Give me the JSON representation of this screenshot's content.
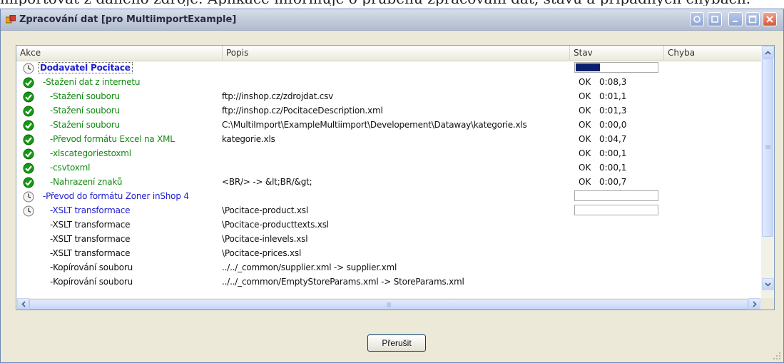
{
  "background_text": "importovat z daného zdroje. Aplikace informuje o průběhu zpracování dat, stavu  a případných chybách.",
  "window": {
    "title": "Zpracování dat [pro MultiimportExample]"
  },
  "columns": [
    "Akce",
    "Popis",
    "Stav",
    "Chyba"
  ],
  "rows": [
    {
      "status": "clock",
      "level": 0,
      "color": "blue",
      "akce": "Dodavatel Pocitace",
      "popis": "",
      "stav": "",
      "cas": "",
      "progress": 0.3
    },
    {
      "status": "ok",
      "level": 1,
      "color": "green",
      "akce": "-Stažení dat z internetu",
      "popis": "",
      "stav": "OK",
      "cas": "0:08,3"
    },
    {
      "status": "ok",
      "level": 2,
      "color": "green",
      "akce": "-Stažení souboru",
      "popis": "ftp://inshop.cz/zdrojdat.csv",
      "stav": "OK",
      "cas": "0:01,1"
    },
    {
      "status": "ok",
      "level": 2,
      "color": "green",
      "akce": "-Stažení souboru",
      "popis": "ftp://inshop.cz/PocitaceDescription.xml",
      "stav": "OK",
      "cas": "0:01,3"
    },
    {
      "status": "ok",
      "level": 2,
      "color": "green",
      "akce": "-Stažení souboru",
      "popis": "C:\\MultiImport\\ExampleMultiimport\\Developement\\Dataway\\kategorie.xls",
      "stav": "OK",
      "cas": "0:00,0"
    },
    {
      "status": "ok",
      "level": 2,
      "color": "green",
      "akce": "-Převod formátu Excel na XML",
      "popis": "kategorie.xls",
      "stav": "OK",
      "cas": "0:04,7"
    },
    {
      "status": "ok",
      "level": 2,
      "color": "green",
      "akce": "-xlscategoriestoxml",
      "popis": "",
      "stav": "OK",
      "cas": "0:00,1"
    },
    {
      "status": "ok",
      "level": 2,
      "color": "green",
      "akce": "-csvtoxml",
      "popis": "",
      "stav": "OK",
      "cas": "0:00,1"
    },
    {
      "status": "ok",
      "level": 2,
      "color": "green",
      "akce": "-Nahrazení znaků",
      "popis": "<BR/> -> &lt;BR/&gt;",
      "stav": "OK",
      "cas": "0:00,7"
    },
    {
      "status": "clock",
      "level": 1,
      "color": "blue",
      "akce": "-Převod do formátu Zoner inShop 4",
      "popis": "",
      "stav": "",
      "cas": "",
      "progress": 0
    },
    {
      "status": "clock",
      "level": 2,
      "color": "blue",
      "akce": "-XSLT transformace",
      "popis": "\\Pocitace-product.xsl",
      "stav": "",
      "cas": "",
      "progress": 0
    },
    {
      "status": "none",
      "level": 2,
      "color": "black",
      "akce": "-XSLT transformace",
      "popis": "\\Pocitace-producttexts.xsl",
      "stav": "",
      "cas": ""
    },
    {
      "status": "none",
      "level": 2,
      "color": "black",
      "akce": "-XSLT transformace",
      "popis": "\\Pocitace-inlevels.xsl",
      "stav": "",
      "cas": ""
    },
    {
      "status": "none",
      "level": 2,
      "color": "black",
      "akce": "-XSLT transformace",
      "popis": "\\Pocitace-prices.xsl",
      "stav": "",
      "cas": ""
    },
    {
      "status": "none",
      "level": 2,
      "color": "black",
      "akce": "-Kopírování souboru",
      "popis": "../../_common/supplier.xml -> supplier.xml",
      "stav": "",
      "cas": ""
    },
    {
      "status": "none",
      "level": 2,
      "color": "black",
      "akce": "-Kopírování souboru",
      "popis": "../../_common/EmptyStoreParams.xml -> StoreParams.xml",
      "stav": "",
      "cas": ""
    }
  ],
  "buttons": {
    "stop_label": "Přerušit"
  },
  "colors": {
    "ok_green": "#139a13",
    "running_blue": "#1d1dcf",
    "progress_fill": "#0a1f6e"
  }
}
